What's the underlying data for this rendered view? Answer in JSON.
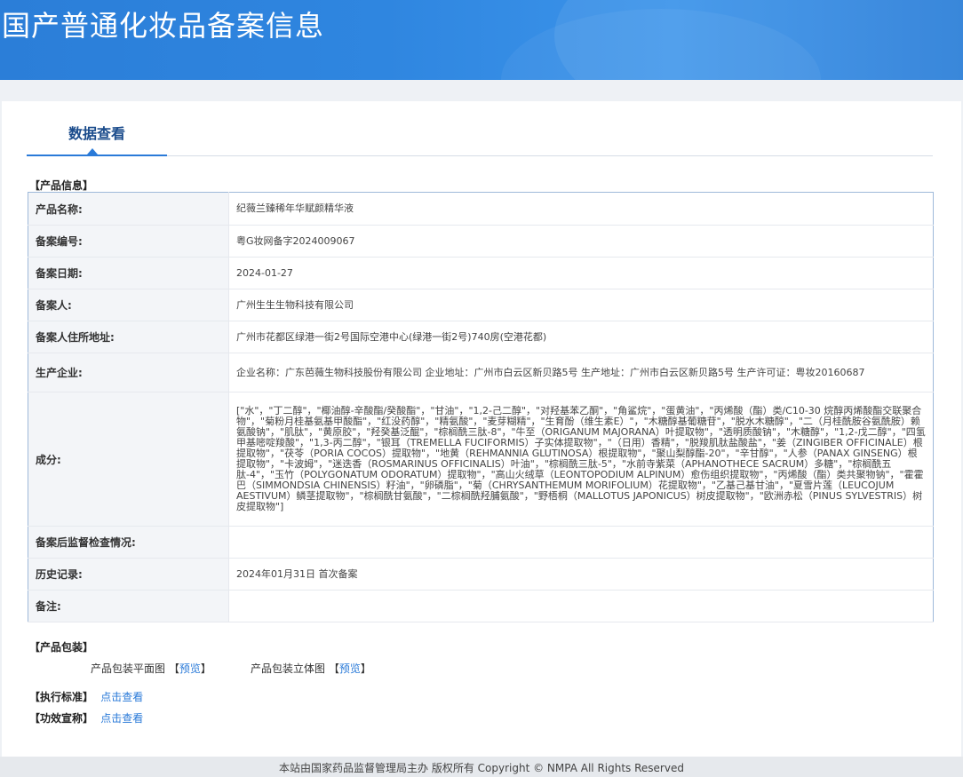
{
  "header": {
    "title": "国产普通化妆品备案信息"
  },
  "tab": {
    "label": "数据查看"
  },
  "sections": {
    "product_info": "【产品信息】",
    "packaging": "【产品包装】",
    "standard": "【执行标准】",
    "claims": "【功效宣称】"
  },
  "product": {
    "rows": [
      {
        "key": "产品名称:",
        "value": "纪薇兰臻稀年华赋颜精华液"
      },
      {
        "key": "备案编号:",
        "value": "粤G妆网备字2024009067"
      },
      {
        "key": "备案日期:",
        "value": "2024-01-27"
      },
      {
        "key": "备案人:",
        "value": "广州生生生物科技有限公司"
      },
      {
        "key": "备案人住所地址:",
        "value": "广州市花都区绿港一街2号国际空港中心(绿港一街2号)740房(空港花都)"
      },
      {
        "key": "生产企业:",
        "value": "企业名称：广东芭薇生物科技股份有限公司 企业地址：广州市白云区新贝路5号 生产地址：广州市白云区新贝路5号 生产许可证：粤妆20160687"
      },
      {
        "key": "成分:",
        "value": "[\"水\"，\"丁二醇\"，\"椰油醇-辛酸酯/癸酸酯\"，\"甘油\"，\"1,2-己二醇\"，\"对羟基苯乙酮\"，\"角鲨烷\"，\"蛋黄油\"，\"丙烯酸（酯）类/C10-30 烷醇丙烯酸酯交联聚合物\"，\"菊粉月桂基氨基甲酸酯\"，\"红没药醇\"，\"精氨酸\"，\"麦芽糊精\"，\"生育酚（维生素E）\"，\"木糖醇基葡糖苷\"，\"脱水木糖醇\"，\"二（月桂酰胺谷氨酰胺）赖氨酸钠\"，\"肌肽\"，\"黄原胶\"，\"羟癸基泛醌\"，\"棕榈酰三肽-8\"，\"牛至（ORIGANUM MAJORANA）叶提取物\"，\"透明质酸钠\"，\"木糖醇\"，\"1,2-戊二醇\"，\"四氢甲基嘧啶羧酸\"，\"1,3-丙二醇\"，\"银耳（TREMELLA FUCIFORMIS）子实体提取物\"，\"（日用）香精\"，\"脱羧肌肽盐酸盐\"，\"姜（ZINGIBER OFFICINALE）根提取物\"，\"茯苓（PORIA COCOS）提取物\"，\"地黄（REHMANNIA GLUTINOSA）根提取物\"，\"聚山梨醇酯-20\"，\"辛甘醇\"，\"人参（PANAX GINSENG）根提取物\"，\"卡波姆\"，\"迷迭香（ROSMARINUS OFFICINALIS）叶油\"，\"棕榈酰三肽-5\"，\"水前寺紫菜（APHANOTHECE SACRUM）多糖\"，\"棕榈酰五肽-4\"，\"玉竹（POLYGONATUM ODORATUM）提取物\"，\"高山火绒草（LEONTOPODIUM ALPINUM）愈伤组织提取物\"，\"丙烯酸（酯）类共聚物钠\"，\"霍霍巴（SIMMONDSIA CHINENSIS）籽油\"，\"卵磷脂\"，\"菊（CHRYSANTHEMUM MORIFOLIUM）花提取物\"，\"乙基己基甘油\"，\"夏雪片莲（LEUCOJUM AESTIVUM）鳞茎提取物\"，\"棕榈酰甘氨酸\"，\"二棕榈酰羟脯氨酸\"，\"野梧桐（MALLOTUS JAPONICUS）树皮提取物\"，\"欧洲赤松（PINUS SYLVESTRIS）树皮提取物\"]"
      },
      {
        "key": "备案后监督检查情况:",
        "value": ""
      },
      {
        "key": "历史记录:",
        "value": "2024年01月31日 首次备案"
      },
      {
        "key": "备注:",
        "value": ""
      }
    ]
  },
  "packaging": {
    "flat_label": "产品包装平面图",
    "flat_link": "预览",
    "stereo_label": "产品包装立体图",
    "stereo_link": "预览",
    "open_bracket": "【",
    "close_bracket": "】"
  },
  "links": {
    "view": "点击查看"
  },
  "footer": {
    "text": "本站由国家药品监督管理局主办 版权所有 Copyright © NMPA All Rights Reserved"
  }
}
